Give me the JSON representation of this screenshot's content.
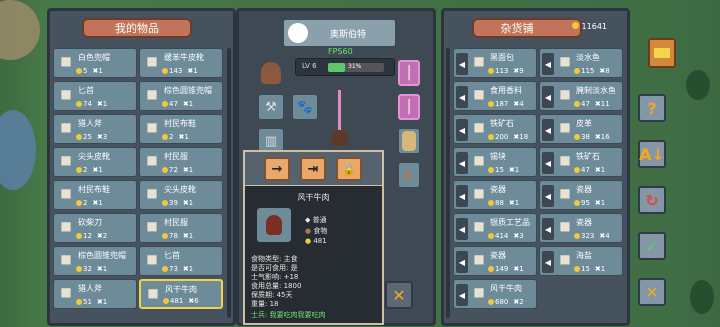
{
  "left_panel": {
    "title": "我的物品",
    "items": [
      {
        "name": "白色兜帽",
        "price": "5",
        "qty": "1",
        "icon": "hood-icon"
      },
      {
        "name": "缓苯牛皮靴",
        "price": "143",
        "qty": "1",
        "icon": "boots-icon"
      },
      {
        "name": "匕首",
        "price": "74",
        "qty": "1",
        "icon": "dagger-icon"
      },
      {
        "name": "棕色圆锥兜帽",
        "price": "47",
        "qty": "1",
        "icon": "hood-icon"
      },
      {
        "name": "猎人斧",
        "price": "25",
        "qty": "3",
        "icon": "axe-icon"
      },
      {
        "name": "村民布鞋",
        "price": "2",
        "qty": "1",
        "icon": "shoes-icon"
      },
      {
        "name": "尖头皮靴",
        "price": "2",
        "qty": "1",
        "icon": "boots-icon"
      },
      {
        "name": "村民服",
        "price": "72",
        "qty": "1",
        "icon": "shirt-icon"
      },
      {
        "name": "村民布鞋",
        "price": "2",
        "qty": "1",
        "icon": "shoes-icon"
      },
      {
        "name": "尖头皮靴",
        "price": "39",
        "qty": "1",
        "icon": "boots-icon"
      },
      {
        "name": "砍柴刀",
        "price": "12",
        "qty": "2",
        "icon": "cleaver-icon"
      },
      {
        "name": "村民服",
        "price": "78",
        "qty": "1",
        "icon": "shirt-icon"
      },
      {
        "name": "棕色圆锥兜帽",
        "price": "32",
        "qty": "1",
        "icon": "hood-icon"
      },
      {
        "name": "匕首",
        "price": "73",
        "qty": "1",
        "icon": "dagger-icon"
      },
      {
        "name": "猎人斧",
        "price": "51",
        "qty": "1",
        "icon": "axe-icon"
      },
      {
        "name": "风干牛肉",
        "price": "481",
        "qty": "6",
        "icon": "meat-icon"
      }
    ]
  },
  "center": {
    "character_name": "奥斯伯特",
    "fps": "FPS60",
    "level": "LV 6",
    "xp_percent": "31%",
    "xp_fraction": 0.31
  },
  "tooltip": {
    "buttons": [
      "→",
      "⇥",
      "🔒"
    ],
    "title": "风干牛肉",
    "quality": "普通",
    "category": "食物",
    "price": "481",
    "lines": [
      "食物类型: 主食",
      "是否可食用: 是",
      "士气影响: +18",
      "食用总量: 1800",
      "保质期: 45天",
      "重量: 18"
    ],
    "flavor_label": "士兵:",
    "flavor_text": "我要吃肉我要吃肉"
  },
  "right_panel": {
    "title": "杂货铺",
    "gold": "11641",
    "items": [
      {
        "name": "黑面包",
        "price": "113",
        "qty": "9",
        "icon": "bread-icon"
      },
      {
        "name": "淡水鱼",
        "price": "115",
        "qty": "8",
        "icon": "fish-icon"
      },
      {
        "name": "食用香料",
        "price": "187",
        "qty": "4",
        "icon": "spice-icon"
      },
      {
        "name": "腌制淡水鱼",
        "price": "47",
        "qty": "11",
        "icon": "fish-icon"
      },
      {
        "name": "铁矿石",
        "price": "200",
        "qty": "18",
        "icon": "ore-icon"
      },
      {
        "name": "皮革",
        "price": "38",
        "qty": "16",
        "icon": "leather-icon"
      },
      {
        "name": "锡块",
        "price": "15",
        "qty": "1",
        "icon": "tin-icon"
      },
      {
        "name": "铁矿石",
        "price": "47",
        "qty": "1",
        "icon": "ore-icon"
      },
      {
        "name": "瓷器",
        "price": "88",
        "qty": "1",
        "icon": "porcelain-icon"
      },
      {
        "name": "瓷器",
        "price": "95",
        "qty": "1",
        "icon": "porcelain-icon"
      },
      {
        "name": "银质工艺品",
        "price": "414",
        "qty": "3",
        "icon": "silver-icon"
      },
      {
        "name": "瓷器",
        "price": "323",
        "qty": "4",
        "icon": "porcelain-icon"
      },
      {
        "name": "瓷器",
        "price": "149",
        "qty": "1",
        "icon": "porcelain-icon"
      },
      {
        "name": "海盐",
        "price": "15",
        "qty": "1",
        "icon": "salt-icon"
      },
      {
        "name": "风干牛肉",
        "price": "680",
        "qty": "2",
        "icon": "meat-icon"
      }
    ]
  },
  "side_buttons": [
    {
      "name": "help-button",
      "glyph": "?"
    },
    {
      "name": "sort-button",
      "glyph": "A↓"
    },
    {
      "name": "refresh-button",
      "glyph": "↻"
    },
    {
      "name": "confirm-button",
      "glyph": "✓"
    },
    {
      "name": "cancel-button",
      "glyph": "✕"
    }
  ],
  "center_close_glyph": "✕"
}
